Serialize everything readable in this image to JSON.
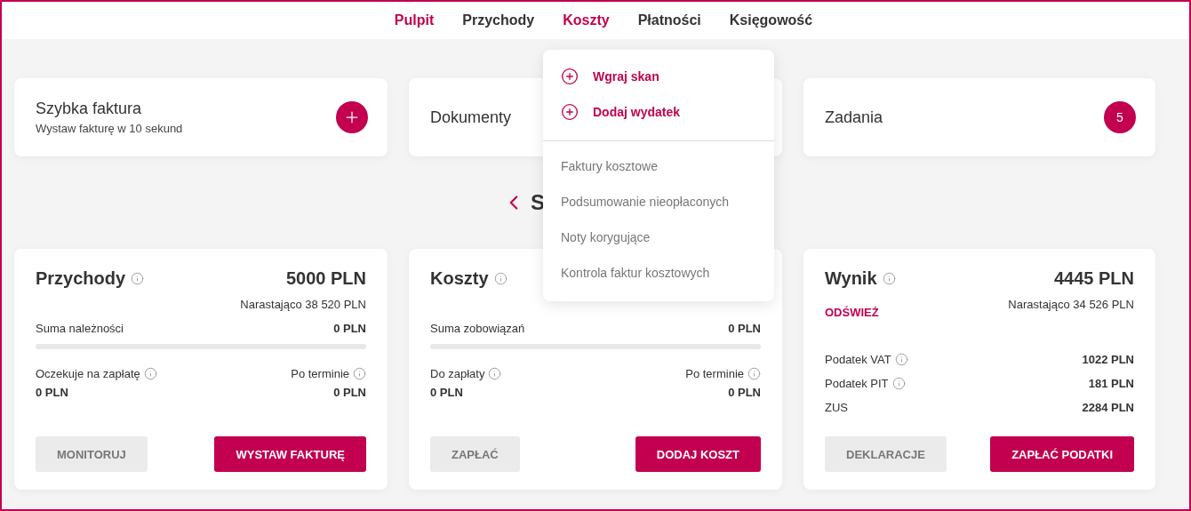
{
  "nav": [
    {
      "label": "Pulpit",
      "selected": true
    },
    {
      "label": "Przychody",
      "selected": false
    },
    {
      "label": "Koszty",
      "selected": true
    },
    {
      "label": "Płatności",
      "selected": false
    },
    {
      "label": "Księgowość",
      "selected": false
    }
  ],
  "dropdown": {
    "items": [
      {
        "kind": "action",
        "label": "Wgraj skan"
      },
      {
        "kind": "action",
        "label": "Dodaj wydatek"
      },
      {
        "kind": "divider"
      },
      {
        "kind": "link",
        "label": "Faktury kosztowe"
      },
      {
        "kind": "link",
        "label": "Podsumowanie nieopłaconych"
      },
      {
        "kind": "link",
        "label": "Noty korygujące"
      },
      {
        "kind": "link",
        "label": "Kontrola faktur kosztowych"
      }
    ]
  },
  "top_cards": [
    {
      "kind": "quick",
      "title": "Szybka faktura",
      "subtitle": "Wystaw fakturę w 10 sekund"
    },
    {
      "kind": "plain",
      "title": "Dokumenty"
    },
    {
      "kind": "count",
      "title": "Zadania",
      "badge": "5"
    }
  ],
  "section_heading": "S",
  "summary_cards": [
    {
      "kind": "balance",
      "title": "Przychody",
      "amount": "5000 PLN",
      "cumulative": "Narastająco 38 520 PLN",
      "sum_label": "Suma należności",
      "sum_value": "0 PLN",
      "level": 0,
      "left_label": "Oczekuje na zapłatę",
      "left_value": "0 PLN",
      "right_label": "Po terminie",
      "right_value": "0 PLN",
      "secondary_button": "MONITORUJ",
      "primary_button": "WYSTAW FAKTURĘ"
    },
    {
      "kind": "balance",
      "title": "Koszty",
      "sum_label": "Suma zobowiązań",
      "sum_value": "0 PLN",
      "level": 0,
      "left_label": "Do zapłaty",
      "left_value": "0 PLN",
      "right_label": "Po terminie",
      "right_value": "0 PLN",
      "secondary_button": "ZAPŁAĆ",
      "primary_button": "DODAJ KOSZT"
    },
    {
      "kind": "result",
      "title": "Wynik",
      "amount": "4445 PLN",
      "cumulative": "Narastająco 34 526 PLN",
      "refresh": "ODŚWIEŻ",
      "taxes": [
        {
          "label": "Podatek VAT",
          "value": "1022 PLN",
          "info": true
        },
        {
          "label": "Podatek PIT",
          "value": "181 PLN",
          "info": true
        },
        {
          "label": "ZUS",
          "value": "2284 PLN",
          "info": false
        }
      ],
      "secondary_button": "DEKLARACJE",
      "primary_button": "ZAPŁAĆ PODATKI"
    }
  ]
}
